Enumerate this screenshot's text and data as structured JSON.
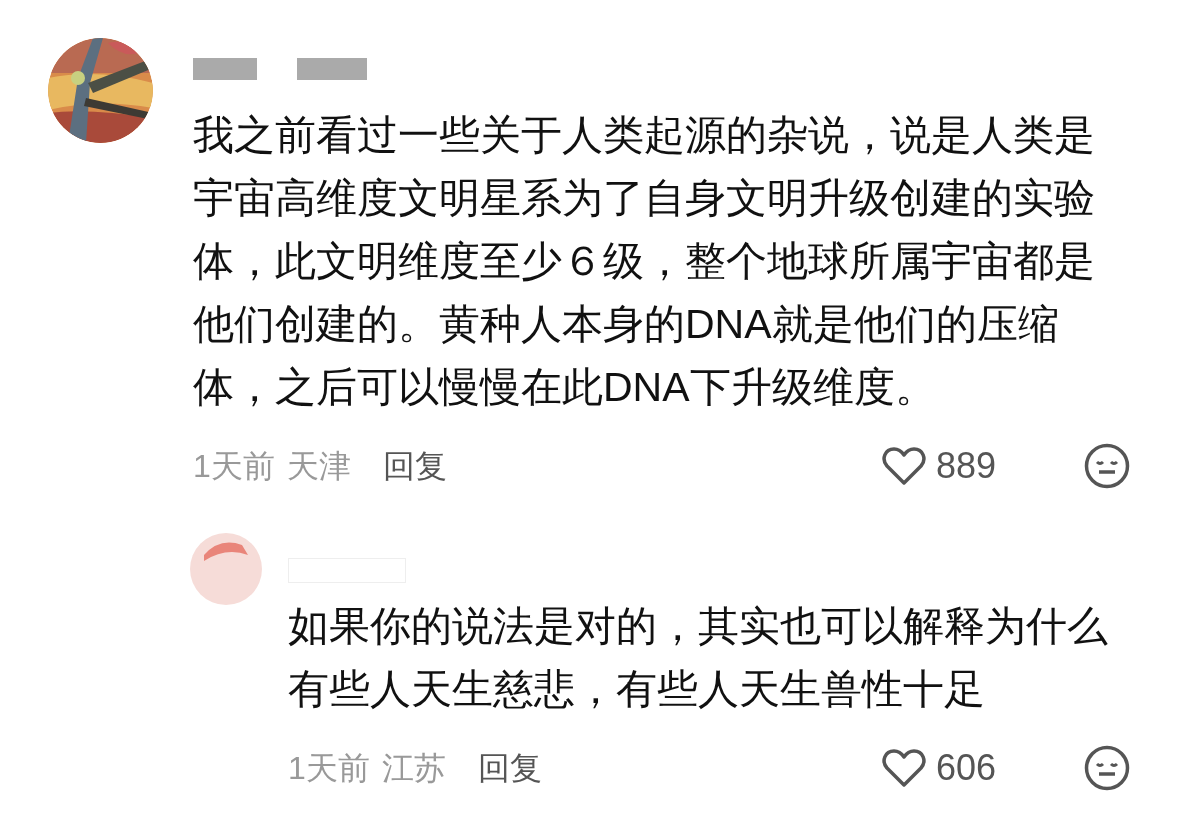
{
  "comments": [
    {
      "text": "我之前看过一些关于人类起源的杂说，说是人类是宇宙高维度文明星系为了自身文明升级创建的实验体，此文明维度至少６级，整个地球所属宇宙都是他们创建的。黄种人本身的DNA就是他们的压缩体，之后可以慢慢在此DNA下升级维度。",
      "time": "1天前",
      "location": "天津",
      "reply_label": "回复",
      "likes": "889",
      "replies": [
        {
          "text": "如果你的说法是对的，其实也可以解释为什么有些人天生慈悲，有些人天生兽性十足",
          "time": "1天前",
          "location": "江苏",
          "reply_label": "回复",
          "likes": "606"
        }
      ]
    }
  ]
}
